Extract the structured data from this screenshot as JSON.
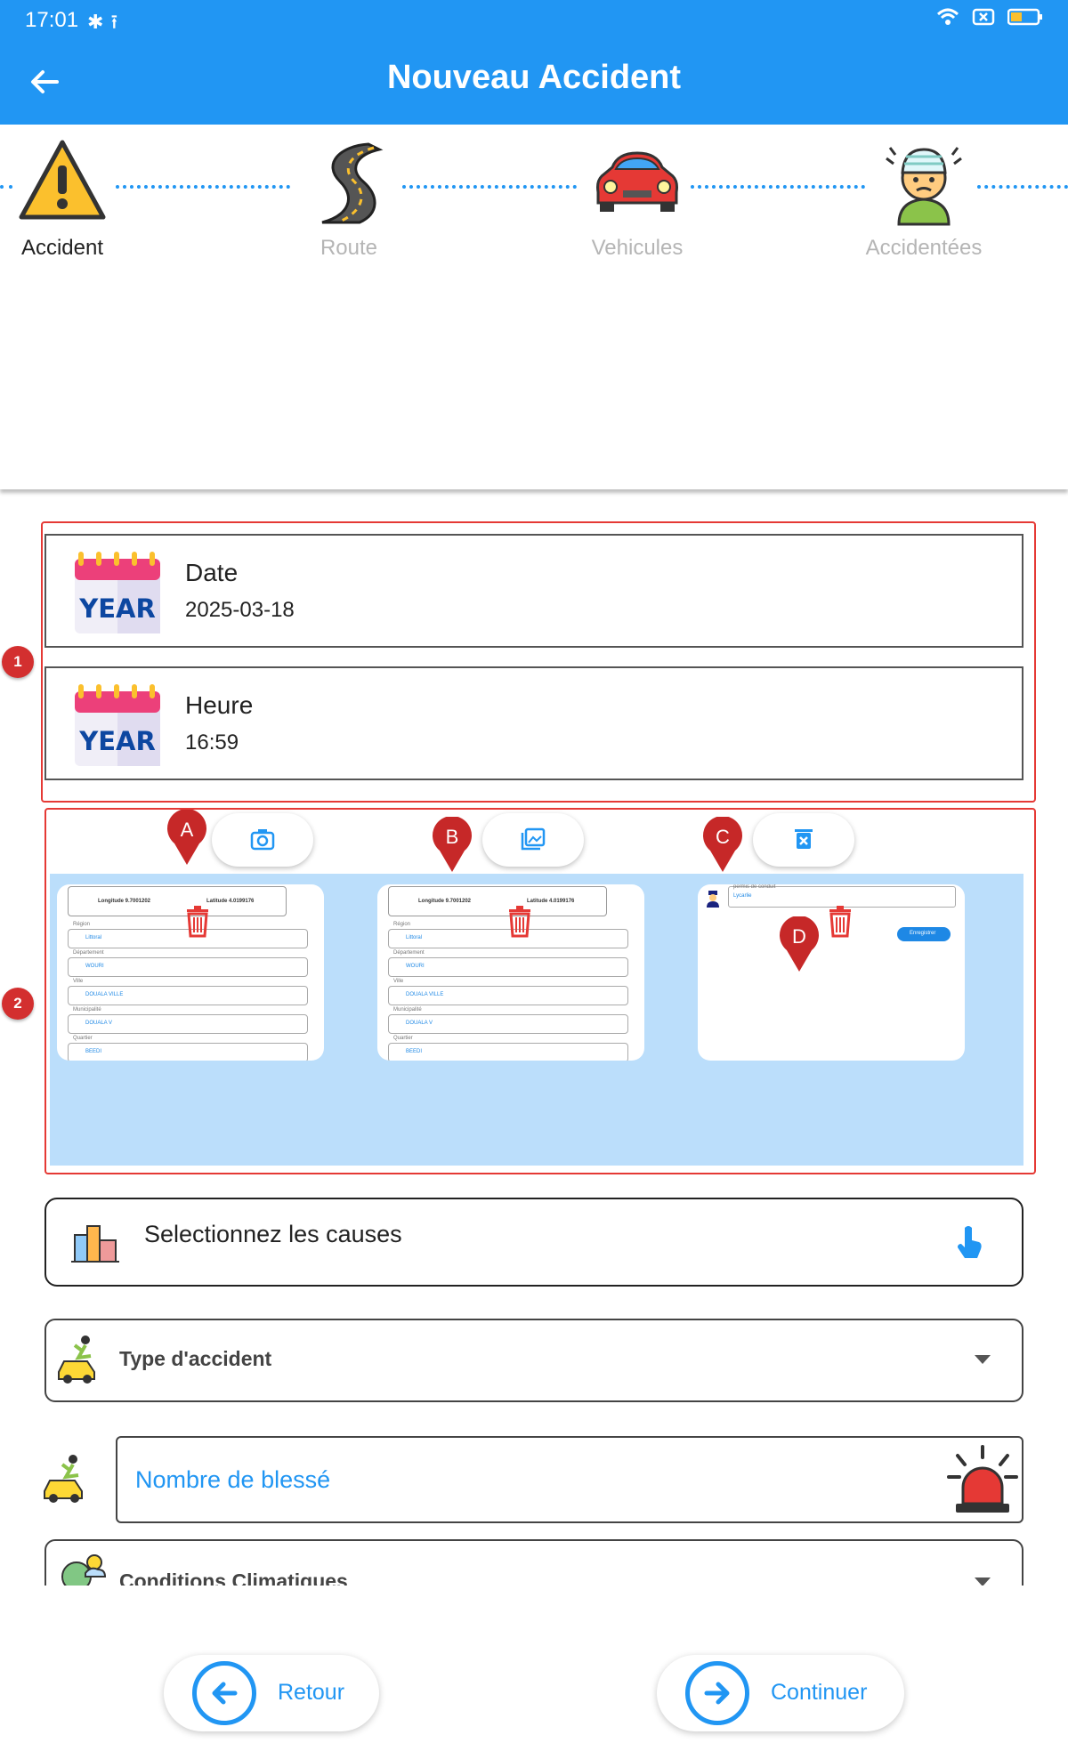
{
  "status_bar": {
    "time": "17:01",
    "left_icons": [
      "bluetooth-icon",
      "upload-icon"
    ],
    "right_icons": [
      "wifi-icon",
      "sim-off-icon",
      "battery-icon"
    ]
  },
  "app_bar": {
    "title": "Nouveau Accident",
    "back_icon": "arrow-left-icon"
  },
  "stepper": {
    "steps": [
      {
        "label": "Accident",
        "icon": "warning-icon",
        "active": true
      },
      {
        "label": "Route",
        "icon": "road-icon",
        "active": false
      },
      {
        "label": "Vehicules",
        "icon": "car-icon",
        "active": false
      },
      {
        "label": "Accidentées",
        "icon": "injured-person-icon",
        "active": false
      }
    ]
  },
  "annotations": {
    "box1_number": "1",
    "box2_number": "2",
    "pin_a": "A",
    "pin_b": "B",
    "pin_c": "C",
    "pin_d": "D"
  },
  "date_card": {
    "label": "Date",
    "value": "2025-03-18",
    "icon_text": "YEAR"
  },
  "time_card": {
    "label": "Heure",
    "value": "16:59",
    "icon_text": "YEAR"
  },
  "photo_actions": {
    "camera_icon": "camera-icon",
    "gallery_icon": "image-gallery-icon",
    "clear_icon": "delete-all-icon",
    "delete_icon": "trash-icon"
  },
  "thumbnails": {
    "longitude": "Longitude 9.7001202",
    "latitude": "Latitude 4.0199176",
    "rows": [
      {
        "caption": "Région",
        "value": "Littoral"
      },
      {
        "caption": "Département",
        "value": "WOURI"
      },
      {
        "caption": "Ville",
        "value": "DOUALA VILLE"
      },
      {
        "caption": "Municipalité",
        "value": "DOUALA V"
      },
      {
        "caption": "Quartier",
        "value": "BEEDI"
      }
    ],
    "third_field_caption": "permis de conduit",
    "third_field_value": "Lycarlie",
    "third_button": "Enregistrer"
  },
  "causes": {
    "label": "Selectionnez les causes"
  },
  "accident_type": {
    "label": "Type d'accident"
  },
  "injured_count": {
    "placeholder": "Nombre de blessé"
  },
  "weather": {
    "label": "Conditions Climatiques"
  },
  "buttons": {
    "back": "Retour",
    "continue": "Continuer"
  },
  "colors": {
    "primary": "#2196f3",
    "annotation_red": "#d32f2f",
    "thumb_bg": "#bbdefb"
  }
}
